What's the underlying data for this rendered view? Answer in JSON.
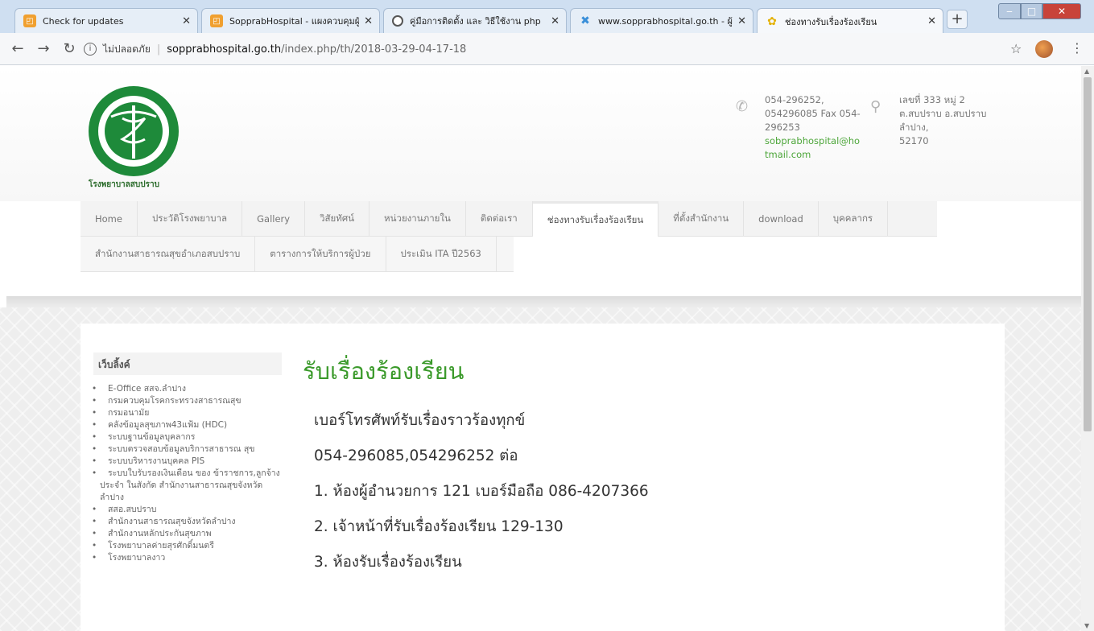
{
  "browser": {
    "tabs": [
      {
        "title": "Check for updates",
        "icon": "orange-app-icon"
      },
      {
        "title": "SopprabHospital - แผงควบคุมผู้",
        "icon": "orange-app-icon"
      },
      {
        "title": "คู่มือการติดตั้ง และ วิธีใช้งาน php",
        "icon": "globe-icon"
      },
      {
        "title": "www.sopprabhospital.go.th - ผู้",
        "icon": "joomla-icon"
      },
      {
        "title": "ช่องทางรับเรื่องร้องเรียน",
        "icon": "hospital-favicon"
      }
    ],
    "address": {
      "security": "ไม่ปลอดภัย",
      "host": "sopprabhospital.go.th",
      "path": "/index.php/th/2018-03-29-04-17-18"
    }
  },
  "header": {
    "logo_text": "โรงพยาบาลสบปราบ",
    "phone": {
      "line1": "054-296252,",
      "line2": "054296085 Fax 054-",
      "line3": "296253",
      "email1": "sobprabhospital@ho",
      "email2": "tmail.com"
    },
    "address": {
      "line1": "เลขที่ 333 หมู่ 2",
      "line2": "ต.สบปราบ อ.สบปราบ",
      "line3": "ลำปาง,",
      "line4": "52170"
    }
  },
  "nav": {
    "row1": [
      "Home",
      "ประวัติโรงพยาบาล",
      "Gallery",
      "วิสัยทัศน์",
      "หน่วยงานภายใน",
      "ติดต่อเรา",
      "ช่องทางรับเรื่องร้องเรียน",
      "ที่ตั้งสำนักงาน",
      "download",
      "บุคคลากร"
    ],
    "row2": [
      "สำนักงานสาธารณสุขอำเภอสบปราบ",
      "ตารางการให้บริการผู้ป่วย",
      "ประเมิน ITA ปี2563"
    ],
    "active": "ช่องทางรับเรื่องร้องเรียน"
  },
  "sidebar": {
    "title": "เว็บลิ้งค์",
    "links": [
      "E-Office สสจ.ลำปาง",
      "กรมควบคุมโรคกระทรวงสาธารณสุข",
      "กรมอนามัย",
      "คลังข้อมูลสุขภาพ43แฟ้ม (HDC)",
      "ระบบฐานข้อมูลบุคลากร",
      "ระบบตรวจสอบข้อมูลบริการสาธารณ สุข",
      "ระบบบริหารงานบุคคล PIS",
      "ระบบใบรับรองเงินเดือน ของ ข้าราชการ,ลูกจ้างประจำ ในสังกัด สำนักงานสาธารณสุขจังหวัดลำปาง",
      "สสอ.สบปราบ",
      "สำนักงานสาธารณสุขจังหวัดลำปาง",
      "สำนักงานหลักประกันสุขภาพ",
      "โรงพยาบาลค่ายสุรศักดิ์มนตรี",
      "โรงพยาบาลงาว"
    ]
  },
  "main": {
    "title": "รับเรื่องร้องเรียน",
    "lines": [
      "เบอร์โทรศัพท์รับเรื่องราวร้องทุกข์",
      "054-296085,054296252 ต่อ",
      "1. ห้องผู้อำนวยการ 121 เบอร์มือถือ 086-4207366",
      "2. เจ้าหน้าที่รับเรื่องร้องเรียน 129-130",
      "3. ห้องรับเรื่องร้องเรียน"
    ]
  }
}
